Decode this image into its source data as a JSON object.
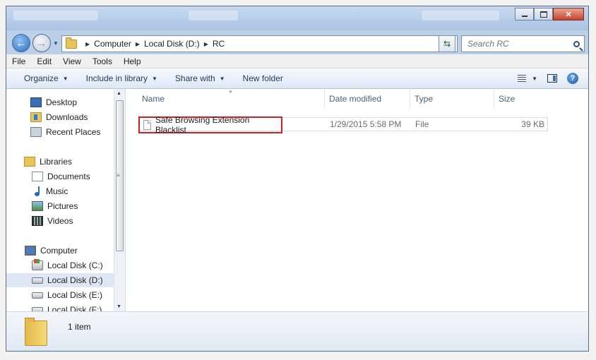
{
  "window": {
    "colors": {
      "frame": "#bcd0e8",
      "highlight": "#d11f24"
    }
  },
  "address": {
    "breadcrumbs": [
      "Computer",
      "Local Disk (D:)",
      "RC"
    ]
  },
  "search": {
    "placeholder": "Search RC"
  },
  "menu": [
    "File",
    "Edit",
    "View",
    "Tools",
    "Help"
  ],
  "commands": {
    "organize": "Organize",
    "include": "Include in library",
    "share": "Share with",
    "new_folder": "New folder"
  },
  "nav": {
    "favorites": [
      "Desktop",
      "Downloads",
      "Recent Places"
    ],
    "libraries_header": "Libraries",
    "libraries": [
      "Documents",
      "Music",
      "Pictures",
      "Videos"
    ],
    "computer_header": "Computer",
    "drives": [
      "Local Disk (C:)",
      "Local Disk (D:)",
      "Local Disk (E:)",
      "Local Disk (F:)"
    ],
    "selected": "Local Disk (D:)"
  },
  "columns": {
    "name": "Name",
    "date": "Date modified",
    "type": "Type",
    "size": "Size"
  },
  "files": [
    {
      "name": "Safe Browsing Extension Blacklist",
      "date": "1/29/2015 5:58 PM",
      "type": "File",
      "size": "39 KB"
    }
  ],
  "status": {
    "item_count": "1 item"
  }
}
